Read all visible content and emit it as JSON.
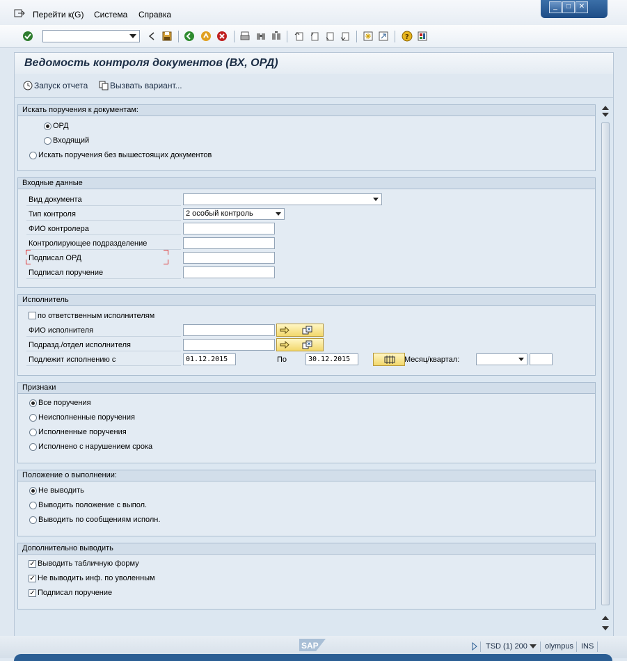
{
  "menu": {
    "goto": "Перейти к(G)",
    "system": "Система",
    "help": "Справка"
  },
  "window_controls": {
    "minimize": "_",
    "maximize": "□",
    "close": "✕"
  },
  "toolbar": {
    "command_field": ""
  },
  "title": "Ведомость контроля документов (ВХ, ОРД)",
  "app_toolbar": {
    "run": "Запуск отчета",
    "variant": "Вызвать вариант..."
  },
  "group_search": {
    "header": "Искать поручения к документам:",
    "opt_ord": "ОРД",
    "opt_incoming": "Входящий",
    "opt_no_parent": "Искать поручения без вышестоящих документов"
  },
  "group_input": {
    "header": "Входные данные",
    "doc_type_label": "Вид документа",
    "doc_type_value": "",
    "control_type_label": "Тип контроля",
    "control_type_value": "2 особый контроль",
    "controller_label": "ФИО контролера",
    "controller_value": "",
    "dept_label": "Контролирующее подразделение",
    "dept_value": "",
    "signed_ord_label": "Подписал ОРД",
    "signed_ord_value": "",
    "signed_order_label": "Подписал поручение",
    "signed_order_value": ""
  },
  "group_exec": {
    "header": "Исполнитель",
    "responsible_label": "по ответственным исполнителям",
    "executor_label": "ФИО исполнителя",
    "executor_value": "",
    "exec_dept_label": "Подразд./отдел исполнителя",
    "exec_dept_value": "",
    "due_label": "Подлежит исполнению с",
    "date_from": "01.12.2015",
    "to_label": "По",
    "date_to": "30.12.2015",
    "month_label": "Месяц/квартал:",
    "month_value": "",
    "quarter_value": ""
  },
  "group_signs": {
    "header": "Признаки",
    "all": "Все поручения",
    "unfulfilled": "Неисполненные поручения",
    "fulfilled": "Исполненные поручения",
    "late": "Исполнено с нарушением срока"
  },
  "group_status": {
    "header": "Положение о выполнении:",
    "none": "Не выводить",
    "with_exec": "Выводить положение с выпол.",
    "by_messages": "Выводить по сообщениям исполн."
  },
  "group_extra": {
    "header": "Дополнительно выводить",
    "table_form": "Выводить табличную форму",
    "no_dismissed": "Не выводить инф. по уволенным",
    "signed_order": "Подписал поручение"
  },
  "status_bar": {
    "logo": "SAP",
    "system": "TSD (1) 200",
    "server": "olympus",
    "mode": "INS"
  }
}
